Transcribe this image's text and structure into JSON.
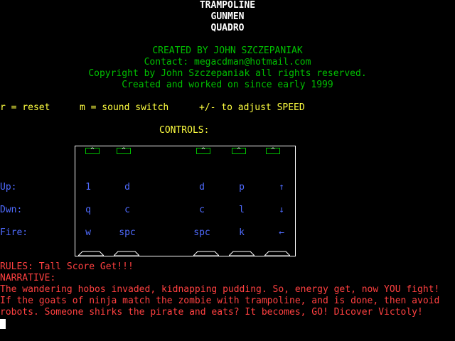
{
  "title": [
    "TRAMPOLINE",
    "GUNMEN",
    "QUADRO"
  ],
  "credits": {
    "created_by": "CREATED BY JOHN SZCZEPANIAK",
    "contact": "Contact: megacdman@hotmail.com",
    "copyright": "Copyright by John Szczepaniak all rights reserved.",
    "since": "Created and worked on since early 1999"
  },
  "hotkeys": {
    "reset": "r = reset",
    "sound": "m = sound switch",
    "speed": "+/- to adjust SPEED"
  },
  "controls_heading": "CONTROLS:",
  "row_labels": {
    "up": "Up:",
    "down": "Dwn:",
    "fire": "Fire:"
  },
  "players": [
    {
      "up": "1",
      "down": "q",
      "fire": "w"
    },
    {
      "up": "d",
      "down": "c",
      "fire": "spc"
    },
    {
      "up": "d",
      "down": "c",
      "fire": "spc"
    },
    {
      "up": "p",
      "down": "l",
      "fire": "k"
    },
    {
      "up": "↑",
      "down": "↓",
      "fire": "←"
    }
  ],
  "marker_glyph": "^",
  "rules": "RULES: Tall Score Get!!!",
  "narrative_heading": "NARRATIVE:",
  "narrative": [
    "The wandering hobos invaded, kidnapping pudding. So, energy get, now YOU fight!",
    "If the goats of ninja match the zombie with trampoline, and is done, then avoid",
    "robots. Someone shirks the pirate and eats? It becomes, GO! Dicover Victoly!"
  ],
  "colors": {
    "background": "#000000",
    "title": "#ffffff",
    "credits": "#00c000",
    "hotkeys": "#ffff40",
    "controls": "#4f6bff",
    "narrative": "#ff4040"
  }
}
